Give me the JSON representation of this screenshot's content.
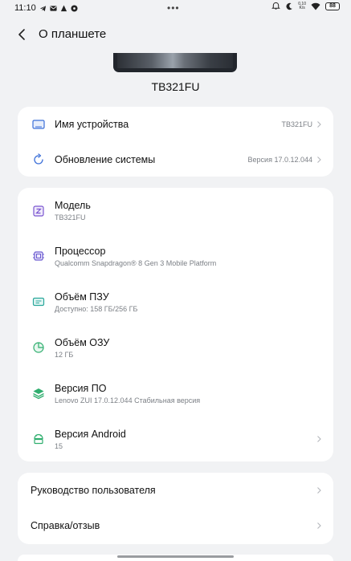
{
  "status_bar": {
    "time": "11:10",
    "dots": "•••",
    "net_speed_value": "0,10",
    "net_speed_unit": "K/s",
    "battery": "88"
  },
  "header": {
    "title": "О планшете"
  },
  "device": {
    "name": "TB321FU"
  },
  "card1": {
    "device_name_label": "Имя устройства",
    "device_name_value": "TB321FU",
    "update_label": "Обновление системы",
    "update_value": "Версия 17.0.12.044"
  },
  "card2": {
    "items": [
      {
        "label": "Модель",
        "sub": "TB321FU",
        "icon": "model-icon"
      },
      {
        "label": "Процессор",
        "sub": "Qualcomm Snapdragon® 8 Gen 3 Mobile Platform",
        "icon": "processor-icon"
      },
      {
        "label": "Объём ПЗУ",
        "sub": "Доступно: 158 ГБ/256 ГБ",
        "icon": "storage-icon"
      },
      {
        "label": "Объём ОЗУ",
        "sub": "12 ГБ",
        "icon": "ram-icon"
      },
      {
        "label": "Версия ПО",
        "sub": "Lenovo ZUI 17.0.12.044 Стабильная версия",
        "icon": "software-layers-icon"
      },
      {
        "label": "Версия Android",
        "sub": "15",
        "icon": "android-icon"
      }
    ]
  },
  "card3": {
    "manual_label": "Руководство пользователя",
    "help_label": "Справка/отзыв"
  },
  "colors": {
    "background": "#f1f2f4",
    "card": "#ffffff",
    "icon_blue": "#3b6fd8",
    "icon_purple": "#7a55d0",
    "icon_teal": "#2aa79b",
    "icon_green": "#2fae6e"
  }
}
